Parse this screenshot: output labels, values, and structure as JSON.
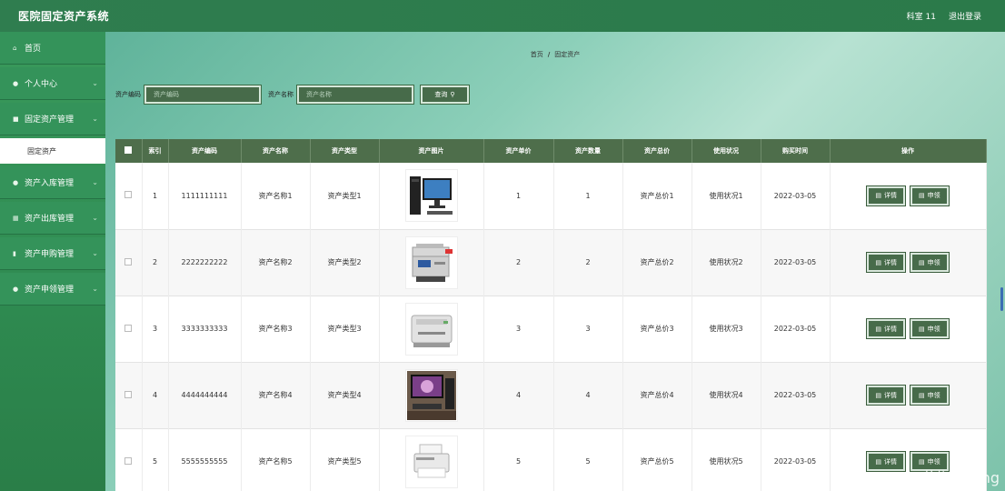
{
  "app": {
    "title": "医院固定资产系统"
  },
  "topbar": {
    "user": "科室 11",
    "logout": "退出登录"
  },
  "sidebar": {
    "items": [
      {
        "label": "首页",
        "icon": "home-icon",
        "glyph": "⌂",
        "has_children": false
      },
      {
        "label": "个人中心",
        "icon": "user-icon",
        "glyph": "●",
        "has_children": true
      },
      {
        "label": "固定资产管理",
        "icon": "list-icon",
        "glyph": "■",
        "has_children": true
      },
      {
        "label": "资产入库管理",
        "icon": "user-icon",
        "glyph": "●",
        "has_children": true
      },
      {
        "label": "资产出库管理",
        "icon": "grid-icon",
        "glyph": "▦",
        "has_children": true
      },
      {
        "label": "资产申购管理",
        "icon": "trash-icon",
        "glyph": "▮",
        "has_children": true
      },
      {
        "label": "资产申领管理",
        "icon": "pin-icon",
        "glyph": "●",
        "has_children": true
      }
    ],
    "sub_item": "固定资产"
  },
  "breadcrumb": {
    "home": "首页",
    "sep": "/",
    "current": "固定资产"
  },
  "search": {
    "code_label": "资产编码",
    "code_placeholder": "资产编码",
    "name_label": "资产名称",
    "name_placeholder": "资产名称",
    "button": "查询"
  },
  "table": {
    "headers": [
      "索引",
      "资产编码",
      "资产名称",
      "资产类型",
      "资产图片",
      "资产单价",
      "资产数量",
      "资产总价",
      "使用状况",
      "购买时间",
      "操作"
    ],
    "rows": [
      {
        "index": "1",
        "code": "1111111111",
        "name": "资产名称1",
        "type": "资产类型1",
        "image": "pc-tower-monitor",
        "price": "1",
        "qty": "1",
        "total": "资产总价1",
        "status": "使用状况1",
        "date": "2022-03-05"
      },
      {
        "index": "2",
        "code": "2222222222",
        "name": "资产名称2",
        "type": "资产类型2",
        "image": "copier",
        "price": "2",
        "qty": "2",
        "total": "资产总价2",
        "status": "使用状况2",
        "date": "2022-03-05"
      },
      {
        "index": "3",
        "code": "3333333333",
        "name": "资产名称3",
        "type": "资产类型3",
        "image": "laser-printer",
        "price": "3",
        "qty": "3",
        "total": "资产总价3",
        "status": "使用状况3",
        "date": "2022-03-05"
      },
      {
        "index": "4",
        "code": "4444444444",
        "name": "资产名称4",
        "type": "资产类型4",
        "image": "desktop-computer",
        "price": "4",
        "qty": "4",
        "total": "资产总价4",
        "status": "使用状况4",
        "date": "2022-03-05"
      },
      {
        "index": "5",
        "code": "5555555555",
        "name": "资产名称5",
        "type": "资产类型5",
        "image": "small-printer",
        "price": "5",
        "qty": "5",
        "total": "资产总价5",
        "status": "使用状况5",
        "date": "2022-03-05"
      }
    ],
    "actions": {
      "detail": "详情",
      "apply": "申领"
    }
  },
  "watermark": "CSDN @花椒coding",
  "colors": {
    "topbar": "#2f7d4f",
    "sidebar": "#34935a",
    "table_header": "#4e6e4b",
    "button": "#476b4a"
  }
}
